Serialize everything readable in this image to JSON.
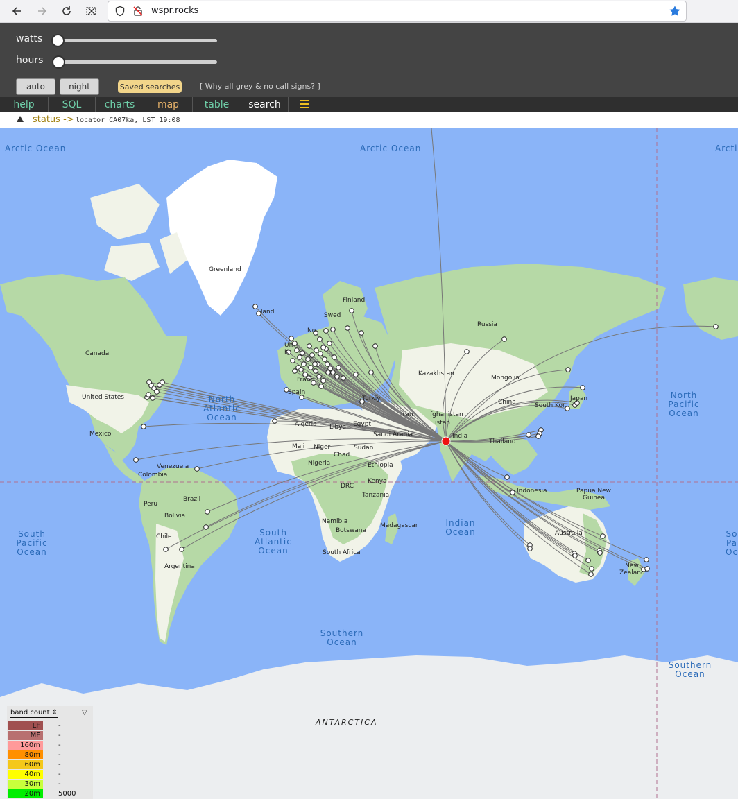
{
  "browser": {
    "url": "wspr.rocks"
  },
  "controls": {
    "watts_label": "watts",
    "hours_label": "hours",
    "auto_label": "auto",
    "night_label": "night",
    "saved_label": "Saved searches",
    "why_label": "[ Why all grey & no call signs? ]"
  },
  "tabs": [
    {
      "label": "help"
    },
    {
      "label": "SQL"
    },
    {
      "label": "charts"
    },
    {
      "label": "map"
    },
    {
      "label": "table"
    },
    {
      "label": "search"
    }
  ],
  "status": {
    "label": "status ->",
    "text": "locator CA07ka, LST 19:08"
  },
  "map": {
    "oceans": {
      "arctic1": "Arctic Ocean",
      "arctic2": "Arctic Ocean",
      "arctic3": "Arcti",
      "north_atlantic": "North Atlantic Ocean",
      "north_pacific": "North Pacific Ocean",
      "south_pacific": "South Pacific Ocean",
      "south_atlantic": "South Atlantic Ocean",
      "indian": "Indian Ocean",
      "southern1": "Southern Ocean",
      "southern2": "Southern Ocean",
      "south_pacific_right": "So Pa Oc"
    },
    "places": {
      "greenland": "Greenland",
      "finland": "Finland",
      "russia": "Russia",
      "canada": "Canada",
      "us": "United States",
      "mexico": "Mexico",
      "venezuela": "Venezuela",
      "colombia": "Colombia",
      "peru": "Peru",
      "brazil": "Brazil",
      "bolivia": "Bolivia",
      "chile": "Chile",
      "argentina": "Argentina",
      "algeria": "Algeria",
      "libya": "Libya",
      "egypt": "Egypt",
      "mali": "Mali",
      "niger": "Niger",
      "chad": "Chad",
      "sudan": "Sudan",
      "nigeria": "Nigeria",
      "ethiopia": "Ethiopia",
      "drc": "DRC",
      "kenya": "Kenya",
      "tanzania": "Tanzania",
      "namibia": "Namibia",
      "botswana": "Botswana",
      "south_africa": "South Africa",
      "madagascar": "Madagascar",
      "saudi": "Saudi Arabia",
      "kazakhstan": "Kazakhstan",
      "mongolia": "Mongolia",
      "china": "China",
      "japan": "Japan",
      "south_korea": "South Kor",
      "india": "India",
      "thailand": "Thailand",
      "indonesia": "Indonesia",
      "png": "Papua New Guinea",
      "australia": "Australia",
      "nz": "New Zealand",
      "antarctica": "ANTARCTICA",
      "france": "Franc",
      "spain": "Spain",
      "turkey": "Turkiy",
      "afghanistan": "fghanistan",
      "iran": "Iran",
      "pakistan": "istan",
      "uk": "Un K",
      "norway": "No",
      "sweden": "Swed",
      "iceland": "land"
    }
  },
  "legend": {
    "title": "band count",
    "rows": [
      {
        "band": "LF",
        "count": "-",
        "color": "#a05050"
      },
      {
        "band": "MF",
        "count": "-",
        "color": "#b87070"
      },
      {
        "band": "160m",
        "count": "-",
        "color": "#ff9a9a"
      },
      {
        "band": "80m",
        "count": "-",
        "color": "#ff9000"
      },
      {
        "band": "60m",
        "count": "-",
        "color": "#f4c81a"
      },
      {
        "band": "40m",
        "count": "-",
        "color": "#ffff00"
      },
      {
        "band": "30m",
        "count": "-",
        "color": "#c8ff3c"
      },
      {
        "band": "20m",
        "count": "5000",
        "color": "#00ee00"
      }
    ]
  },
  "colors": {
    "ocean": "#8ab4f8",
    "land": "#f1f3e8",
    "vegetation": "#b6d9a6",
    "ice": "#ffffff",
    "transmitter": "#ee1111"
  }
}
